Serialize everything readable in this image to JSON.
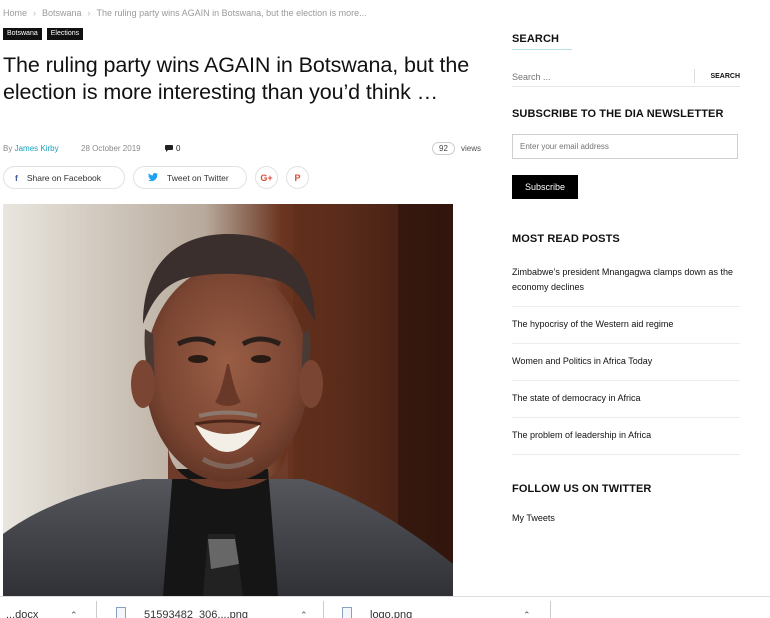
{
  "breadcrumb": {
    "home": "Home",
    "section": "Botswana",
    "current": "The ruling party wins AGAIN in Botswana, but the election is more..."
  },
  "categories": [
    "Botswana",
    "Elections"
  ],
  "article": {
    "title": "The ruling party wins AGAIN in Botswana, but the election is more interesting than you’d think …",
    "by": "By",
    "author": "James Kirby",
    "date": "28 October 2019",
    "comments": "0",
    "views_count": "92",
    "views_label": "views"
  },
  "share": {
    "facebook": "Share on Facebook",
    "twitter": "Tweet on Twitter",
    "gplus": "G+",
    "pinterest": "P"
  },
  "sidebar": {
    "search_title": "SEARCH",
    "search_placeholder": "Search ...",
    "search_button": "SEARCH",
    "newsletter_title": "SUBSCRIBE TO THE DIA NEWSLETTER",
    "email_placeholder": "Enter your email address",
    "subscribe_button": "Subscribe",
    "most_read_title": "MOST READ POSTS",
    "most_read": [
      "Zimbabwe’s president Mnangagwa clamps down as the economy declines",
      "The hypocrisy of the Western aid regime",
      "Women and Politics in Africa Today",
      "The state of democracy in Africa",
      "The problem of leadership in Africa"
    ],
    "twitter_title": "FOLLOW US ON TWITTER",
    "tweets_link": "My Tweets"
  },
  "downloads": [
    {
      "name": "...docx"
    },
    {
      "name": "51593482_306....png"
    },
    {
      "name": "logo.png"
    }
  ],
  "colors": {
    "accent": "#17a2c0",
    "category_bg": "#111111",
    "button_bg": "#000000",
    "gplus": "#dc4a38",
    "facebook": "#3b5998",
    "twitter": "#1da1f2"
  }
}
